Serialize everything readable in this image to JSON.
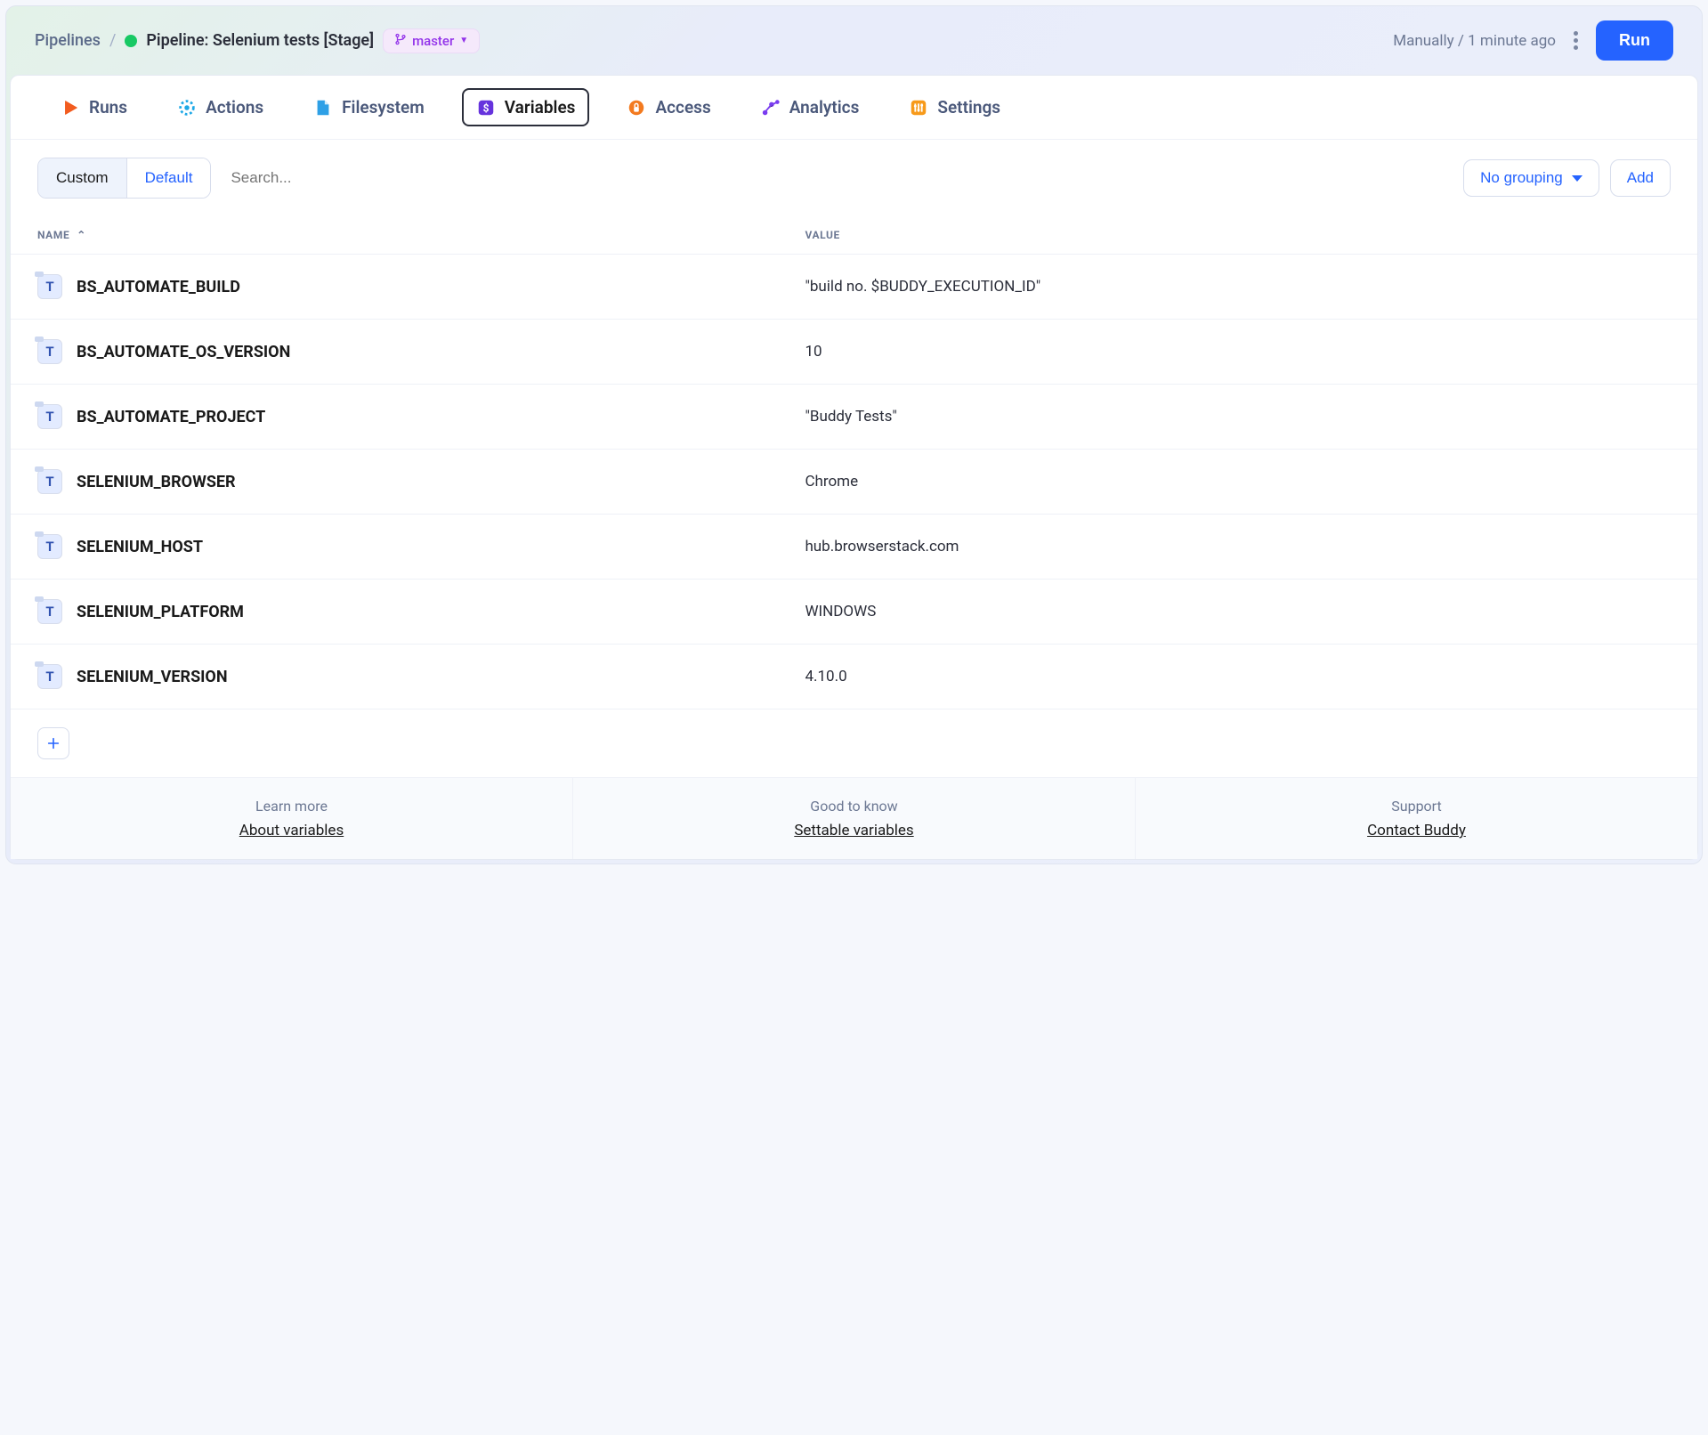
{
  "breadcrumb": {
    "root": "Pipelines",
    "title": "Pipeline: Selenium tests [Stage]"
  },
  "branch": {
    "label": "master"
  },
  "header": {
    "meta": "Manually / 1 minute ago",
    "run": "Run"
  },
  "tabs": [
    {
      "label": "Runs"
    },
    {
      "label": "Actions"
    },
    {
      "label": "Filesystem"
    },
    {
      "label": "Variables"
    },
    {
      "label": "Access"
    },
    {
      "label": "Analytics"
    },
    {
      "label": "Settings"
    }
  ],
  "filter": {
    "custom": "Custom",
    "default": "Default",
    "search_placeholder": "Search...",
    "grouping": "No grouping",
    "add": "Add"
  },
  "table": {
    "col_name": "NAME",
    "col_value": "VALUE",
    "rows": [
      {
        "name": "BS_AUTOMATE_BUILD",
        "value": "\"build no. $BUDDY_EXECUTION_ID\""
      },
      {
        "name": "BS_AUTOMATE_OS_VERSION",
        "value": "10"
      },
      {
        "name": "BS_AUTOMATE_PROJECT",
        "value": "\"Buddy Tests\""
      },
      {
        "name": "SELENIUM_BROWSER",
        "value": "Chrome"
      },
      {
        "name": "SELENIUM_HOST",
        "value": "hub.browserstack.com"
      },
      {
        "name": "SELENIUM_PLATFORM",
        "value": "WINDOWS"
      },
      {
        "name": "SELENIUM_VERSION",
        "value": "4.10.0"
      }
    ]
  },
  "footer": {
    "a_title": "Learn more",
    "a_link": "About variables",
    "b_title": "Good to know",
    "b_link": "Settable variables",
    "c_title": "Support",
    "c_link": "Contact Buddy"
  }
}
